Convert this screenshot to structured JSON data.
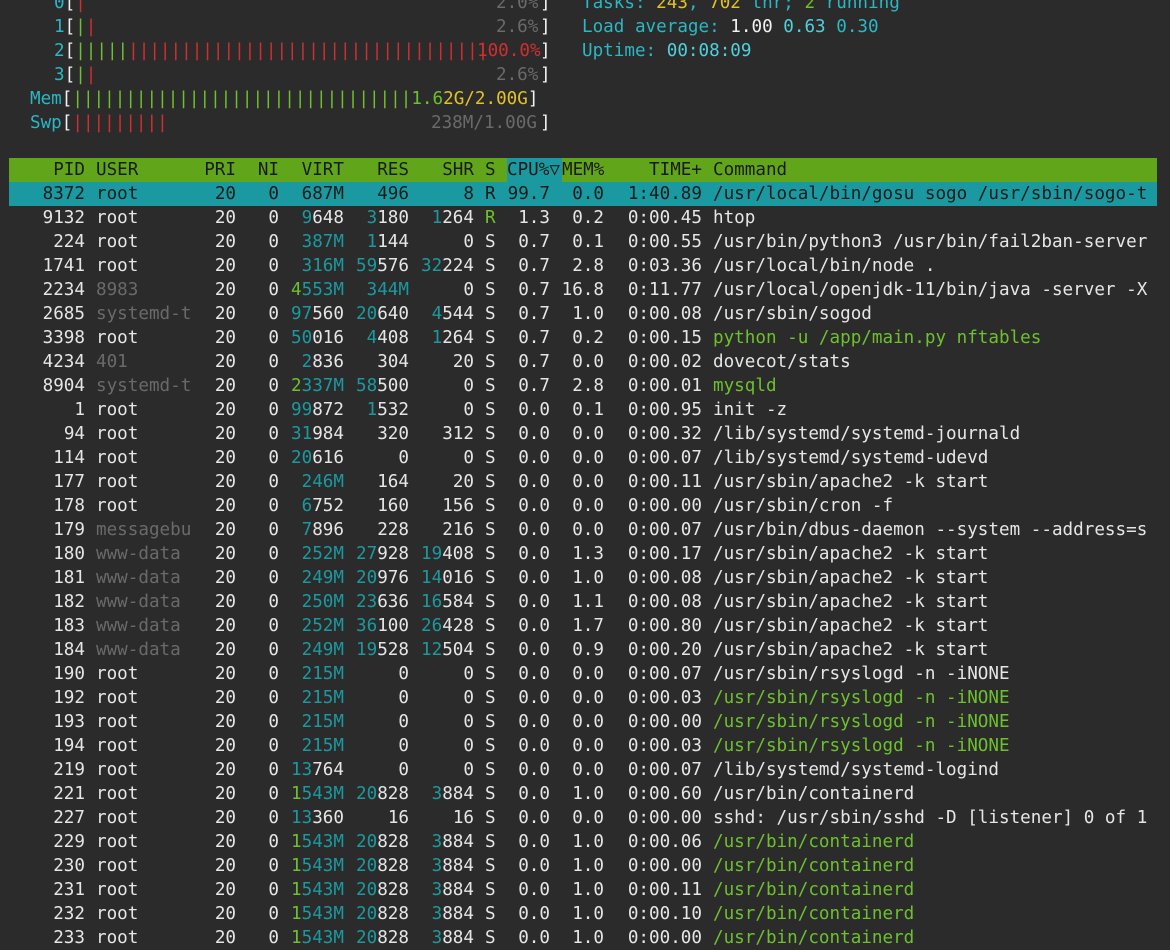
{
  "meters": {
    "cpus": [
      {
        "label": "0",
        "bar_red": "|",
        "bar_grn": "",
        "value": "2.0%"
      },
      {
        "label": "1",
        "bar_red": "|",
        "bar_grn": "|",
        "value": "2.6%"
      },
      {
        "label": "2",
        "bar_red": "||||||||||||||||||||||||||||||||||",
        "bar_grn": "|||||",
        "value": "100.0%"
      },
      {
        "label": "3",
        "bar_red": "|",
        "bar_grn": "|",
        "value": "2.6%"
      }
    ],
    "mem": {
      "label": "Mem",
      "bar": "||||||||||||||||||||||||||||||||",
      "value_a": "1.6",
      "value_b": "2G/2.00G"
    },
    "swp": {
      "label": "Swp",
      "bar": "|||||||||",
      "value": "238M/1.00G"
    }
  },
  "summary": {
    "tasks_label": "Tasks: ",
    "tasks": "243",
    "thr_sep": ", ",
    "thr": "702",
    "thr_label": " thr; ",
    "running": "2",
    "running_label": " running",
    "load_label": "Load average: ",
    "load1": "1.00",
    "load5": "0.63",
    "load15": "0.30",
    "uptime_label": "Uptime: ",
    "uptime": "00:08:09"
  },
  "header": {
    "pid": "PID",
    "user": "USER",
    "pri": "PRI",
    "ni": "NI",
    "virt": "VIRT",
    "res": "RES",
    "shr": "SHR",
    "s": "S",
    "cpu": "CPU%",
    "sort_icon": "▽",
    "mem": "MEM%",
    "time": "TIME+",
    "command": "Command"
  },
  "processes": [
    {
      "pid": "8372",
      "user": "root",
      "pri": "20",
      "ni": "0",
      "virt": "687M",
      "res": "496",
      "shr": "8",
      "s": "R",
      "cpu": "99.7",
      "mem": "0.0",
      "time": "1:40.89",
      "cmd": "/usr/local/bin/gosu sogo /usr/sbin/sogo-t"
    },
    {
      "pid": "9132",
      "user": "root",
      "pri": "20",
      "ni": "0",
      "virt": "9648",
      "res": "3180",
      "shr": "1264",
      "s": "R",
      "cpu": "1.3",
      "mem": "0.2",
      "time": "0:00.45",
      "cmd": "htop"
    },
    {
      "pid": "224",
      "user": "root",
      "pri": "20",
      "ni": "0",
      "virt": "387M",
      "res": "1144",
      "shr": "0",
      "s": "S",
      "cpu": "0.7",
      "mem": "0.1",
      "time": "0:00.55",
      "cmd": "/usr/bin/python3 /usr/bin/fail2ban-server"
    },
    {
      "pid": "1741",
      "user": "root",
      "pri": "20",
      "ni": "0",
      "virt": "316M",
      "res": "59576",
      "shr": "32224",
      "s": "S",
      "cpu": "0.7",
      "mem": "2.8",
      "time": "0:03.36",
      "cmd": "/usr/local/bin/node ."
    },
    {
      "pid": "2234",
      "user": "8983",
      "pri": "20",
      "ni": "0",
      "virt": "4553M",
      "res": "344M",
      "shr": "0",
      "s": "S",
      "cpu": "0.7",
      "mem": "16.8",
      "time": "0:11.77",
      "cmd": "/usr/local/openjdk-11/bin/java -server -X"
    },
    {
      "pid": "2685",
      "user": "systemd-t",
      "pri": "20",
      "ni": "0",
      "virt": "97560",
      "res": "20640",
      "shr": "4544",
      "s": "S",
      "cpu": "0.7",
      "mem": "1.0",
      "time": "0:00.08",
      "cmd": "/usr/sbin/sogod"
    },
    {
      "pid": "3398",
      "user": "root",
      "pri": "20",
      "ni": "0",
      "virt": "50016",
      "res": "4408",
      "shr": "1264",
      "s": "S",
      "cpu": "0.7",
      "mem": "0.2",
      "time": "0:00.15",
      "cmd": "python -u /app/main.py nftables"
    },
    {
      "pid": "4234",
      "user": "401",
      "pri": "20",
      "ni": "0",
      "virt": "2836",
      "res": "304",
      "shr": "20",
      "s": "S",
      "cpu": "0.7",
      "mem": "0.0",
      "time": "0:00.02",
      "cmd": "dovecot/stats"
    },
    {
      "pid": "8904",
      "user": "systemd-t",
      "pri": "20",
      "ni": "0",
      "virt": "2337M",
      "res": "58500",
      "shr": "0",
      "s": "S",
      "cpu": "0.7",
      "mem": "2.8",
      "time": "0:00.01",
      "cmd": "mysqld"
    },
    {
      "pid": "1",
      "user": "root",
      "pri": "20",
      "ni": "0",
      "virt": "99872",
      "res": "1532",
      "shr": "0",
      "s": "S",
      "cpu": "0.0",
      "mem": "0.1",
      "time": "0:00.95",
      "cmd": "init -z"
    },
    {
      "pid": "94",
      "user": "root",
      "pri": "20",
      "ni": "0",
      "virt": "31984",
      "res": "320",
      "shr": "312",
      "s": "S",
      "cpu": "0.0",
      "mem": "0.0",
      "time": "0:00.32",
      "cmd": "/lib/systemd/systemd-journald"
    },
    {
      "pid": "114",
      "user": "root",
      "pri": "20",
      "ni": "0",
      "virt": "20616",
      "res": "0",
      "shr": "0",
      "s": "S",
      "cpu": "0.0",
      "mem": "0.0",
      "time": "0:00.07",
      "cmd": "/lib/systemd/systemd-udevd"
    },
    {
      "pid": "177",
      "user": "root",
      "pri": "20",
      "ni": "0",
      "virt": "246M",
      "res": "164",
      "shr": "20",
      "s": "S",
      "cpu": "0.0",
      "mem": "0.0",
      "time": "0:00.11",
      "cmd": "/usr/sbin/apache2 -k start"
    },
    {
      "pid": "178",
      "user": "root",
      "pri": "20",
      "ni": "0",
      "virt": "6752",
      "res": "160",
      "shr": "156",
      "s": "S",
      "cpu": "0.0",
      "mem": "0.0",
      "time": "0:00.00",
      "cmd": "/usr/sbin/cron -f"
    },
    {
      "pid": "179",
      "user": "messagebu",
      "pri": "20",
      "ni": "0",
      "virt": "7896",
      "res": "228",
      "shr": "216",
      "s": "S",
      "cpu": "0.0",
      "mem": "0.0",
      "time": "0:00.07",
      "cmd": "/usr/bin/dbus-daemon --system --address=s"
    },
    {
      "pid": "180",
      "user": "www-data",
      "pri": "20",
      "ni": "0",
      "virt": "252M",
      "res": "27928",
      "shr": "19408",
      "s": "S",
      "cpu": "0.0",
      "mem": "1.3",
      "time": "0:00.17",
      "cmd": "/usr/sbin/apache2 -k start"
    },
    {
      "pid": "181",
      "user": "www-data",
      "pri": "20",
      "ni": "0",
      "virt": "249M",
      "res": "20976",
      "shr": "14016",
      "s": "S",
      "cpu": "0.0",
      "mem": "1.0",
      "time": "0:00.08",
      "cmd": "/usr/sbin/apache2 -k start"
    },
    {
      "pid": "182",
      "user": "www-data",
      "pri": "20",
      "ni": "0",
      "virt": "250M",
      "res": "23636",
      "shr": "16584",
      "s": "S",
      "cpu": "0.0",
      "mem": "1.1",
      "time": "0:00.08",
      "cmd": "/usr/sbin/apache2 -k start"
    },
    {
      "pid": "183",
      "user": "www-data",
      "pri": "20",
      "ni": "0",
      "virt": "252M",
      "res": "36100",
      "shr": "26428",
      "s": "S",
      "cpu": "0.0",
      "mem": "1.7",
      "time": "0:00.80",
      "cmd": "/usr/sbin/apache2 -k start"
    },
    {
      "pid": "184",
      "user": "www-data",
      "pri": "20",
      "ni": "0",
      "virt": "249M",
      "res": "19528",
      "shr": "12504",
      "s": "S",
      "cpu": "0.0",
      "mem": "0.9",
      "time": "0:00.20",
      "cmd": "/usr/sbin/apache2 -k start"
    },
    {
      "pid": "190",
      "user": "root",
      "pri": "20",
      "ni": "0",
      "virt": "215M",
      "res": "0",
      "shr": "0",
      "s": "S",
      "cpu": "0.0",
      "mem": "0.0",
      "time": "0:00.07",
      "cmd": "/usr/sbin/rsyslogd -n -iNONE"
    },
    {
      "pid": "192",
      "user": "root",
      "pri": "20",
      "ni": "0",
      "virt": "215M",
      "res": "0",
      "shr": "0",
      "s": "S",
      "cpu": "0.0",
      "mem": "0.0",
      "time": "0:00.03",
      "cmd": "/usr/sbin/rsyslogd -n -iNONE"
    },
    {
      "pid": "193",
      "user": "root",
      "pri": "20",
      "ni": "0",
      "virt": "215M",
      "res": "0",
      "shr": "0",
      "s": "S",
      "cpu": "0.0",
      "mem": "0.0",
      "time": "0:00.00",
      "cmd": "/usr/sbin/rsyslogd -n -iNONE"
    },
    {
      "pid": "194",
      "user": "root",
      "pri": "20",
      "ni": "0",
      "virt": "215M",
      "res": "0",
      "shr": "0",
      "s": "S",
      "cpu": "0.0",
      "mem": "0.0",
      "time": "0:00.03",
      "cmd": "/usr/sbin/rsyslogd -n -iNONE"
    },
    {
      "pid": "219",
      "user": "root",
      "pri": "20",
      "ni": "0",
      "virt": "13764",
      "res": "0",
      "shr": "0",
      "s": "S",
      "cpu": "0.0",
      "mem": "0.0",
      "time": "0:00.07",
      "cmd": "/lib/systemd/systemd-logind"
    },
    {
      "pid": "221",
      "user": "root",
      "pri": "20",
      "ni": "0",
      "virt": "1543M",
      "res": "20828",
      "shr": "3884",
      "s": "S",
      "cpu": "0.0",
      "mem": "1.0",
      "time": "0:00.60",
      "cmd": "/usr/bin/containerd"
    },
    {
      "pid": "227",
      "user": "root",
      "pri": "20",
      "ni": "0",
      "virt": "13360",
      "res": "16",
      "shr": "16",
      "s": "S",
      "cpu": "0.0",
      "mem": "0.0",
      "time": "0:00.00",
      "cmd": "sshd: /usr/sbin/sshd -D [listener] 0 of 1"
    },
    {
      "pid": "229",
      "user": "root",
      "pri": "20",
      "ni": "0",
      "virt": "1543M",
      "res": "20828",
      "shr": "3884",
      "s": "S",
      "cpu": "0.0",
      "mem": "1.0",
      "time": "0:00.06",
      "cmd": "/usr/bin/containerd"
    },
    {
      "pid": "230",
      "user": "root",
      "pri": "20",
      "ni": "0",
      "virt": "1543M",
      "res": "20828",
      "shr": "3884",
      "s": "S",
      "cpu": "0.0",
      "mem": "1.0",
      "time": "0:00.00",
      "cmd": "/usr/bin/containerd"
    },
    {
      "pid": "231",
      "user": "root",
      "pri": "20",
      "ni": "0",
      "virt": "1543M",
      "res": "20828",
      "shr": "3884",
      "s": "S",
      "cpu": "0.0",
      "mem": "1.0",
      "time": "0:00.11",
      "cmd": "/usr/bin/containerd"
    },
    {
      "pid": "232",
      "user": "root",
      "pri": "20",
      "ni": "0",
      "virt": "1543M",
      "res": "20828",
      "shr": "3884",
      "s": "S",
      "cpu": "0.0",
      "mem": "1.0",
      "time": "0:00.10",
      "cmd": "/usr/bin/containerd"
    },
    {
      "pid": "233",
      "user": "root",
      "pri": "20",
      "ni": "0",
      "virt": "1543M",
      "res": "20828",
      "shr": "3884",
      "s": "S",
      "cpu": "0.0",
      "mem": "1.0",
      "time": "0:00.00",
      "cmd": "/usr/bin/containerd"
    }
  ]
}
